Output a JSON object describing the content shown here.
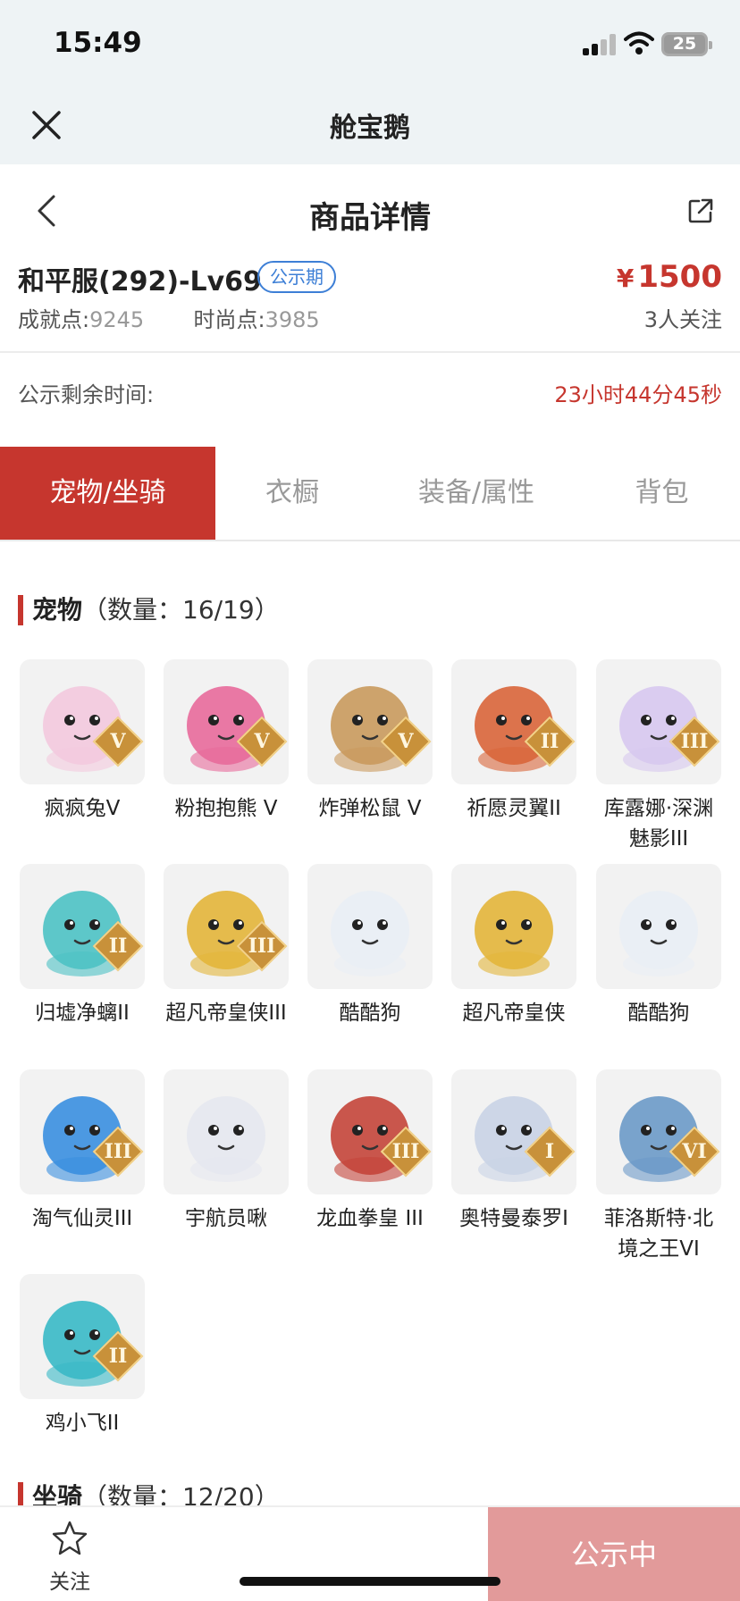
{
  "status_bar": {
    "time": "15:49",
    "battery": "25"
  },
  "app": {
    "title": "舱宝鹅"
  },
  "nav": {
    "title": "商品详情"
  },
  "product": {
    "server": "和平服(292)-Lv69",
    "badge": "公示期",
    "price_symbol": "¥",
    "price": "1500",
    "achievement_label": "成就点:",
    "achievement_value": "9245",
    "fashion_label": "时尚点:",
    "fashion_value": "3985",
    "followers": "3人关注",
    "remaining_label": "公示剩余时间:",
    "remaining_value": "23小时44分45秒"
  },
  "tabs": [
    "宠物/坐骑",
    "衣橱",
    "装备/属性",
    "背包"
  ],
  "pets_section": {
    "title": "宠物",
    "count": "（数量：16/19）",
    "items": [
      {
        "name": "疯疯兔V",
        "rank": "V",
        "color": "#f3c9de"
      },
      {
        "name": "粉抱抱熊 V",
        "rank": "V",
        "color": "#e86a9b"
      },
      {
        "name": "炸弹松鼠 V",
        "rank": "V",
        "color": "#c99a5d"
      },
      {
        "name": "祈愿灵翼II",
        "rank": "II",
        "color": "#d9653a"
      },
      {
        "name": "库露娜·深渊魅影III",
        "rank": "III",
        "color": "#d7c8ef"
      },
      {
        "name": "归墟净螭II",
        "rank": "II",
        "color": "#4cc2c4"
      },
      {
        "name": "超凡帝皇侠III",
        "rank": "III",
        "color": "#e3b53a"
      },
      {
        "name": "酷酷狗",
        "rank": "",
        "color": "#e9eef5"
      },
      {
        "name": "超凡帝皇侠",
        "rank": "",
        "color": "#e3b53a"
      },
      {
        "name": "酷酷狗",
        "rank": "",
        "color": "#e9eef5"
      },
      {
        "name": "淘气仙灵III",
        "rank": "III",
        "color": "#3a8fe0"
      },
      {
        "name": "宇航员啾",
        "rank": "",
        "color": "#e6e8f0"
      },
      {
        "name": "龙血拳皇 III",
        "rank": "III",
        "color": "#c4453a"
      },
      {
        "name": "奥特曼泰罗I",
        "rank": "I",
        "color": "#c9d3e6"
      },
      {
        "name": "菲洛斯特·北境之王VI",
        "rank": "VI",
        "color": "#6c9ac8"
      },
      {
        "name": "鸡小飞II",
        "rank": "II",
        "color": "#39b9c7"
      }
    ]
  },
  "mounts_section": {
    "title": "坐骑",
    "count": "（数量：12/20）"
  },
  "bottom": {
    "follow_label": "关注",
    "status_label": "公示中"
  },
  "colors": {
    "accent": "#c6362e",
    "badge": "#3d7fd6",
    "status_button": "#e29a9a"
  }
}
